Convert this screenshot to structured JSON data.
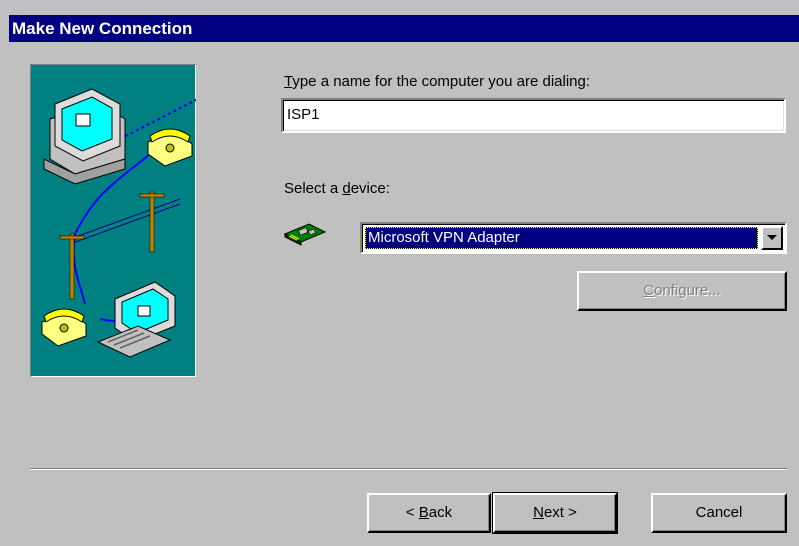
{
  "window": {
    "title": "Make New Connection"
  },
  "form": {
    "name_label_pre": "",
    "name_label_accel": "T",
    "name_label_post": "ype a name for the computer you are dialing:",
    "name_value": "ISP1",
    "device_label_pre": "Select a ",
    "device_label_accel": "d",
    "device_label_post": "evice:",
    "device_selected": "Microsoft VPN Adapter",
    "device_icon": "network-adapter-icon",
    "configure_accel": "C",
    "configure_rest": "onfigure..."
  },
  "buttons": {
    "back_pre": "< ",
    "back_accel": "B",
    "back_post": "ack",
    "next_accel": "N",
    "next_post": "ext >",
    "cancel": "Cancel"
  },
  "illustration": {
    "description_icons": [
      "desktop-computer-icon",
      "telephone-icon",
      "telephone-pole-icon",
      "laptop-icon"
    ]
  },
  "colors": {
    "titlebar": "#000080",
    "face": "#c0c0c0",
    "illustration_bg": "#008080",
    "selection": "#000080"
  }
}
